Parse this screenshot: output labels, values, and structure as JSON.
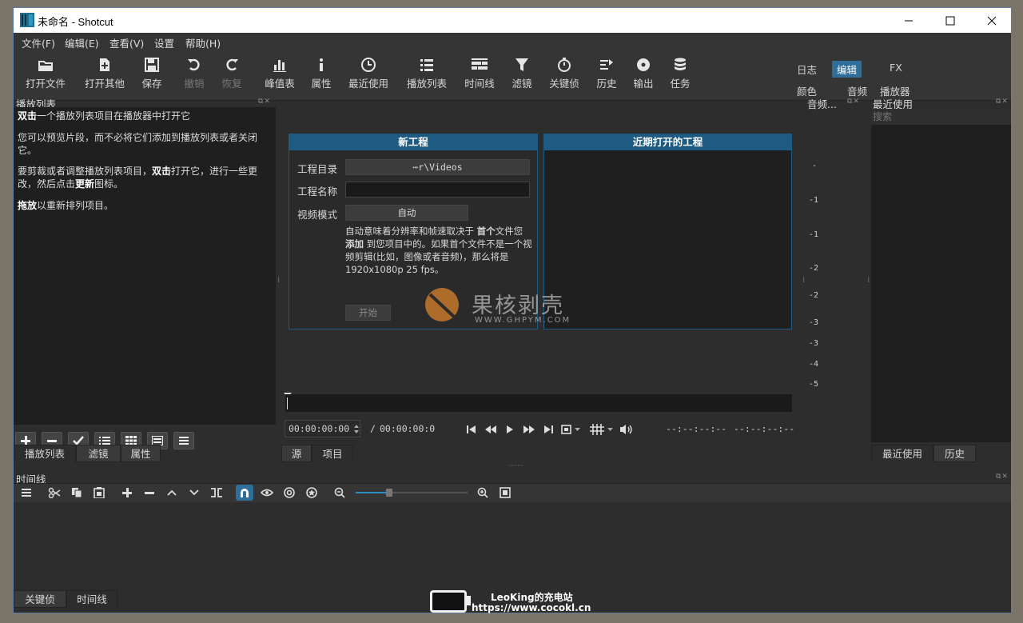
{
  "window": {
    "title": "未命名 - Shotcut"
  },
  "menu": [
    "文件(F)",
    "编辑(E)",
    "查看(V)",
    "设置",
    "帮助(H)"
  ],
  "toolbar": {
    "open_file": "打开文件",
    "open_other": "打开其他",
    "save": "保存",
    "undo": "撤销",
    "redo": "恢复",
    "peak_meter": "峰值表",
    "properties": "属性",
    "recent": "最近使用",
    "playlist": "播放列表",
    "timeline": "时间线",
    "filters": "滤镜",
    "keyframes": "关键侦",
    "history": "历史",
    "export": "输出",
    "jobs": "任务"
  },
  "workspaces": {
    "logs": "日志",
    "editing": "编辑",
    "fx": "FX",
    "color": "颜色",
    "audio": "音频",
    "player": "播放器"
  },
  "playlist_panel": {
    "title": "播放列表",
    "help": [
      {
        "pre": "",
        "bold": "双击",
        "post": "一个播放列表项目在播放器中打开它"
      },
      {
        "pre": "您可以预览片段，而不必将它们添加到播放列表或者关闭它。",
        "bold": "",
        "post": ""
      },
      {
        "pre": "要剪裁或者调整播放列表项目，",
        "bold": "双击",
        "post": "打开它，进行一些更改，然后点击"
      },
      {
        "pre": "",
        "bold": "拖放",
        "post": "以重新排列项目。"
      }
    ],
    "update_word": "更新",
    "icon_word": "图标。",
    "tabs": [
      "播放列表",
      "滤镜",
      "属性"
    ]
  },
  "new_project": {
    "header": "新工程",
    "dir_label": "工程目录",
    "dir_value": "⋯r\\Videos",
    "name_label": "工程名称",
    "name_value": "",
    "mode_label": "视频模式",
    "mode_value": "自动",
    "desc_1": "自动意味着分辨率和帧速取决于 ",
    "desc_b1": "首个",
    "desc_2": "文件您 ",
    "desc_b2": "添加",
    "desc_3": " 到您项目中的。如果首个文件不是一个视频剪辑(比如，图像或者音频)，那么将是 1920x1080p 25 fps。",
    "start": "开始"
  },
  "recent_projects": {
    "header": "近期打开的工程"
  },
  "audio_meter": {
    "title": "音频...",
    "scale": [
      "-",
      "-1",
      "-1",
      "-2",
      "-2",
      "-3",
      "-3",
      "-4",
      "-5"
    ]
  },
  "recent_panel": {
    "title": "最近使用",
    "search_placeholder": "搜索",
    "tabs": [
      "最近使用",
      "历史"
    ]
  },
  "player": {
    "position": "00:00:00:00",
    "separator": "/",
    "duration": "00:00:00:0",
    "in_point": "--:--:--:--",
    "out_point": "--:--:--:--",
    "tabs": [
      "源",
      "项目"
    ]
  },
  "timeline_panel": {
    "title": "时间线",
    "zoom": 0.3
  },
  "bottom_tabs": [
    "关键侦",
    "时间线"
  ],
  "watermark": {
    "brand": "果核剥壳",
    "url": "WWW.GHPYM.COM"
  },
  "overlay": {
    "line1": "LeoKing的充电站",
    "line2": "https://www.cocokl.cn"
  }
}
